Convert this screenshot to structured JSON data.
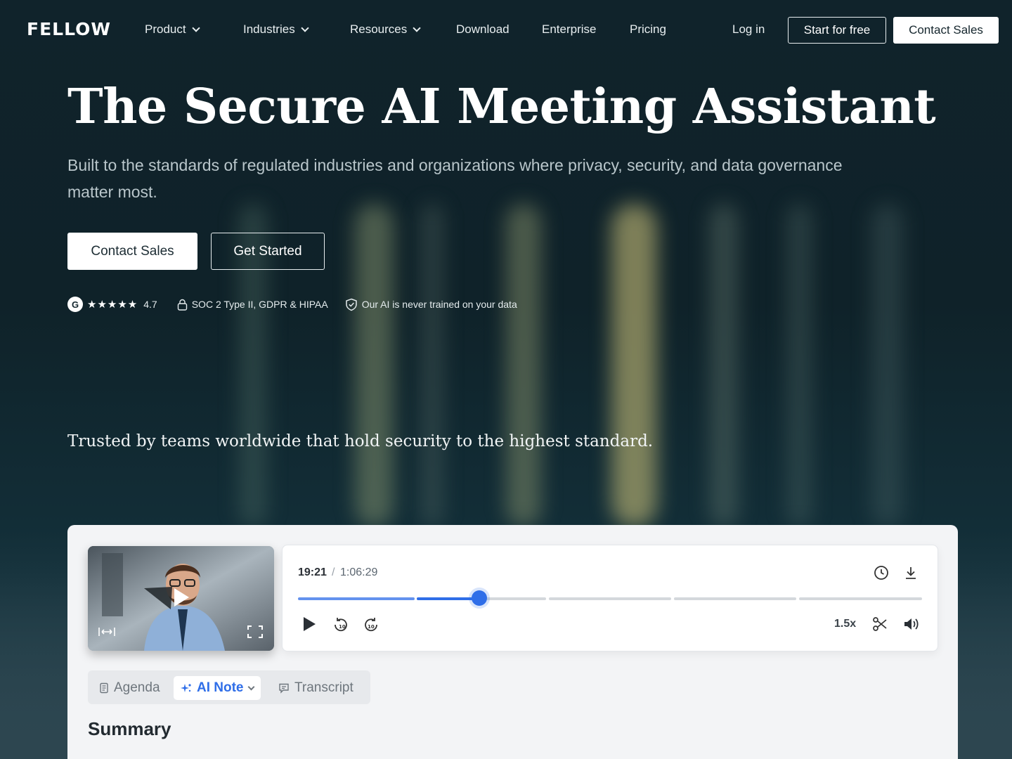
{
  "nav": {
    "logo": "FELLOW",
    "items": [
      {
        "label": "Product",
        "has_dropdown": true
      },
      {
        "label": "Industries",
        "has_dropdown": true
      },
      {
        "label": "Resources",
        "has_dropdown": true
      },
      {
        "label": "Download",
        "has_dropdown": false
      },
      {
        "label": "Enterprise",
        "has_dropdown": false
      },
      {
        "label": "Pricing",
        "has_dropdown": false
      }
    ],
    "login": "Log in",
    "start_free": "Start for free",
    "contact_sales": "Contact Sales"
  },
  "hero": {
    "title": "The Secure AI Meeting Assistant",
    "subtitle": "Built to the standards of regulated industries and organizations where privacy, security, and data governance matter most.",
    "cta_primary": "Contact Sales",
    "cta_secondary": "Get Started"
  },
  "badges": {
    "g2_logo": "G",
    "stars": "★★★★★",
    "rating": "4.7",
    "compliance": "SOC 2 Type II, GDPR & HIPAA",
    "ai_privacy": "Our AI is never trained on your data"
  },
  "trusted": "Trusted by teams worldwide that hold security to the highest standard.",
  "player": {
    "current_time": "19:21",
    "separator": "/",
    "total_time": "1:06:29",
    "progress_fraction": 0.29,
    "speed": "1.5x"
  },
  "tabs": [
    {
      "label": "Agenda",
      "active": false
    },
    {
      "label": "AI Note",
      "active": true
    },
    {
      "label": "Transcript",
      "active": false
    }
  ],
  "summary": {
    "heading": "Summary"
  },
  "colors": {
    "accent_blue": "#2f6ee8",
    "page_bg": "#0f2129"
  }
}
